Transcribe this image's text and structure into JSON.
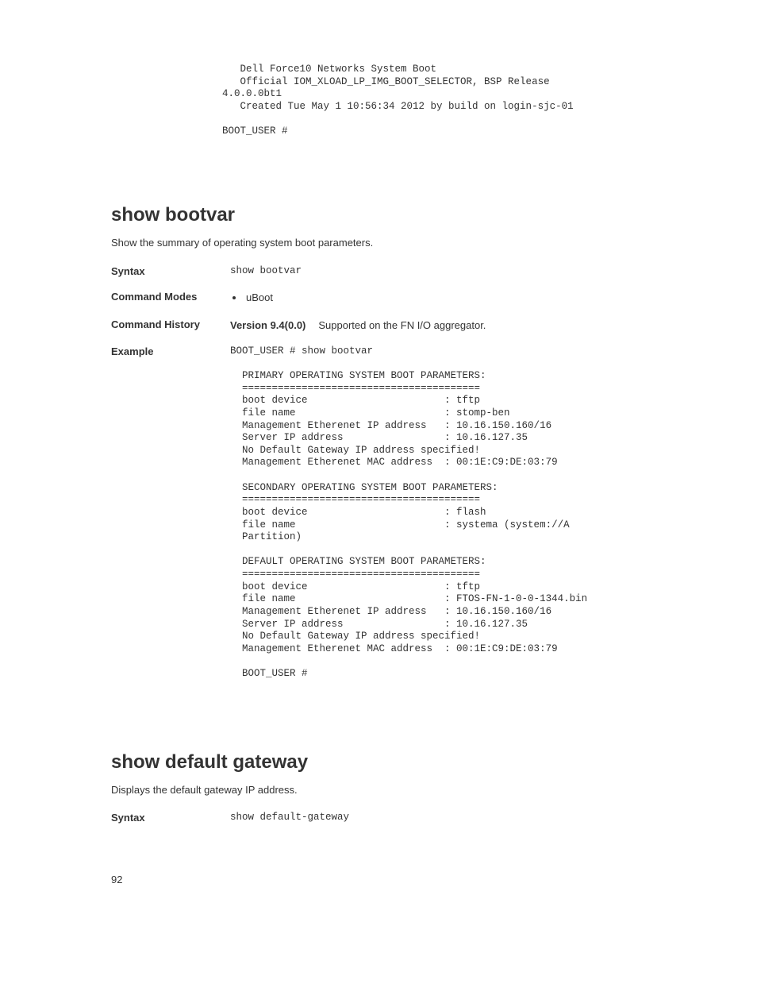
{
  "intro_code": "   Dell Force10 Networks System Boot\n   Official IOM_XLOAD_LP_IMG_BOOT_SELECTOR, BSP Release \n4.0.0.0bt1\n   Created Tue May 1 10:56:34 2012 by build on login-sjc-01\n\nBOOT_USER #",
  "sec1": {
    "heading": "show bootvar",
    "desc": "Show the summary of operating system boot parameters.",
    "rows": {
      "syntax_label": "Syntax",
      "syntax_code": "show bootvar",
      "modes_label": "Command Modes",
      "modes_item": "uBoot",
      "history_label": "Command History",
      "version_label": "Version 9.4(0.0)",
      "version_text": "Supported on the FN I/O aggregator.",
      "example_label": "Example",
      "example_code": "BOOT_USER # show bootvar\n\n  PRIMARY OPERATING SYSTEM BOOT PARAMETERS:\n  ========================================\n  boot device                       : tftp\n  file name                         : stomp-ben\n  Management Etherenet IP address   : 10.16.150.160/16\n  Server IP address                 : 10.16.127.35\n  No Default Gateway IP address specified!\n  Management Etherenet MAC address  : 00:1E:C9:DE:03:79\n\n  SECONDARY OPERATING SYSTEM BOOT PARAMETERS:\n  ========================================\n  boot device                       : flash\n  file name                         : systema (system://A \n  Partition)\n\n  DEFAULT OPERATING SYSTEM BOOT PARAMETERS:\n  ========================================\n  boot device                       : tftp\n  file name                         : FTOS-FN-1-0-0-1344.bin\n  Management Etherenet IP address   : 10.16.150.160/16\n  Server IP address                 : 10.16.127.35\n  No Default Gateway IP address specified!\n  Management Etherenet MAC address  : 00:1E:C9:DE:03:79\n\n  BOOT_USER #"
    }
  },
  "sec2": {
    "heading": "show default gateway",
    "desc": "Displays the default gateway IP address.",
    "rows": {
      "syntax_label": "Syntax",
      "syntax_code": "show default-gateway"
    }
  },
  "page_number": "92"
}
